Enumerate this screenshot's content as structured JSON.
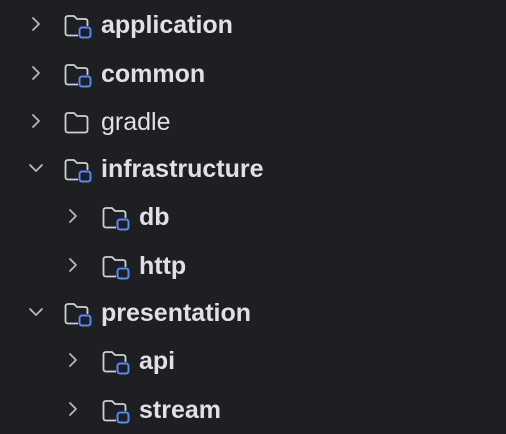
{
  "colors": {
    "background": "#1e1f22",
    "text": "#dfe1e5",
    "chevron": "#b4b8bf",
    "folder_outline": "#ced0d6",
    "module_badge": "#548af7"
  },
  "tree": {
    "items": [
      {
        "label": "application",
        "icon": "module-folder-icon",
        "chevron": "collapsed",
        "level": 0,
        "bold": true
      },
      {
        "label": "common",
        "icon": "module-folder-icon",
        "chevron": "collapsed",
        "level": 0,
        "bold": true
      },
      {
        "label": "gradle",
        "icon": "folder-icon",
        "chevron": "collapsed",
        "level": 0,
        "bold": false
      },
      {
        "label": "infrastructure",
        "icon": "module-folder-icon",
        "chevron": "expanded",
        "level": 0,
        "bold": true
      },
      {
        "label": "db",
        "icon": "module-folder-icon",
        "chevron": "collapsed",
        "level": 1,
        "bold": true
      },
      {
        "label": "http",
        "icon": "module-folder-icon",
        "chevron": "collapsed",
        "level": 1,
        "bold": true
      },
      {
        "label": "presentation",
        "icon": "module-folder-icon",
        "chevron": "expanded",
        "level": 0,
        "bold": true
      },
      {
        "label": "api",
        "icon": "module-folder-icon",
        "chevron": "collapsed",
        "level": 1,
        "bold": true
      },
      {
        "label": "stream",
        "icon": "module-folder-icon",
        "chevron": "collapsed",
        "level": 1,
        "bold": true
      }
    ]
  }
}
